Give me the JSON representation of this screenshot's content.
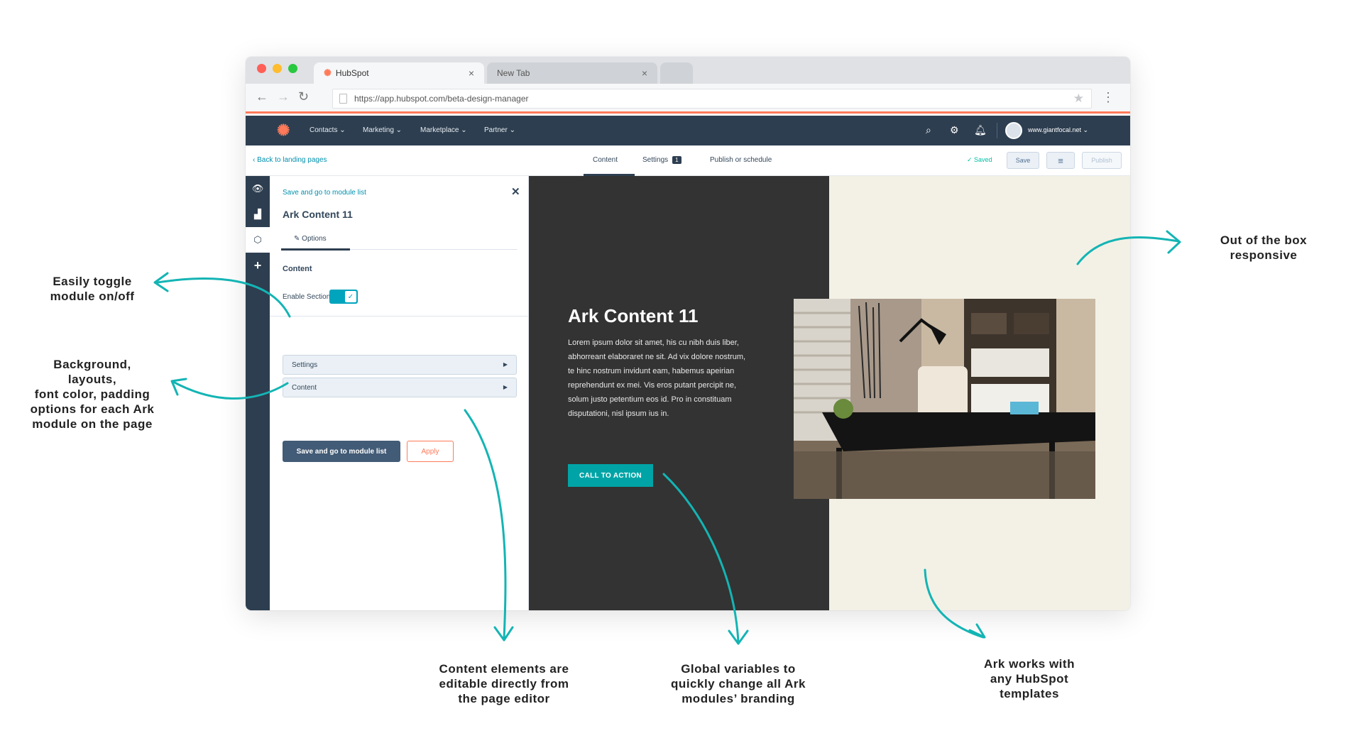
{
  "browser": {
    "tabs": [
      {
        "label": "HubSpot"
      },
      {
        "label": "New Tab"
      }
    ],
    "url": "https://app.hubspot.com/beta-design-manager"
  },
  "hubspot_nav": {
    "items": [
      "Contacts ⌄",
      "Marketing ⌄",
      "Marketplace ⌄",
      "Partner ⌄"
    ],
    "account": "www.giantfocal.net ⌄"
  },
  "editor": {
    "back_link": "‹  Back to landing pages",
    "tabs": {
      "content": "Content",
      "settings": "Settings",
      "settings_badge": "1",
      "publish": "Publish or schedule"
    },
    "saved": "✓  Saved",
    "save_button": "Save",
    "publish_button": "Publish"
  },
  "panel": {
    "top_link": "Save and go to module list",
    "title": "Ark Content 11",
    "options_tab": "Options",
    "section_label": "Content",
    "enable_label": "Enable Section",
    "accordions": [
      "Settings",
      "Content"
    ],
    "primary_button": "Save and go to module list",
    "secondary_button": "Apply"
  },
  "preview": {
    "title": "Ark Content 11",
    "body": "Lorem ipsum dolor sit amet, his cu nibh duis liber, abhorreant elaboraret ne sit. Ad vix dolore nostrum, te hinc nostrum invidunt eam, habemus apeirian reprehendunt ex mei. Vis eros putant percipit ne, solum justo petentium eos id. Pro in constituam disputationi, nisl ipsum ius in.",
    "cta": "CALL TO ACTION"
  },
  "annotations": {
    "toggle": [
      "Easily toggle",
      "module on/off"
    ],
    "background": [
      "Background,",
      "layouts,",
      "font color, padding",
      "options for each Ark",
      "module on the page"
    ],
    "responsive": [
      "Out of the box",
      "responsive"
    ],
    "content_elements": [
      "Content elements are",
      "editable directly from",
      "the page editor"
    ],
    "global_vars": [
      "Global variables to",
      "quickly change all Ark",
      "modules’ branding"
    ],
    "templates": [
      "Ark works with",
      "any HubSpot",
      "templates"
    ]
  },
  "colors": {
    "accent_teal": "#00a4bd",
    "hubspot_orange": "#ff7a59",
    "nav_dark": "#2d3e50",
    "arrow": "#14b4b4"
  }
}
